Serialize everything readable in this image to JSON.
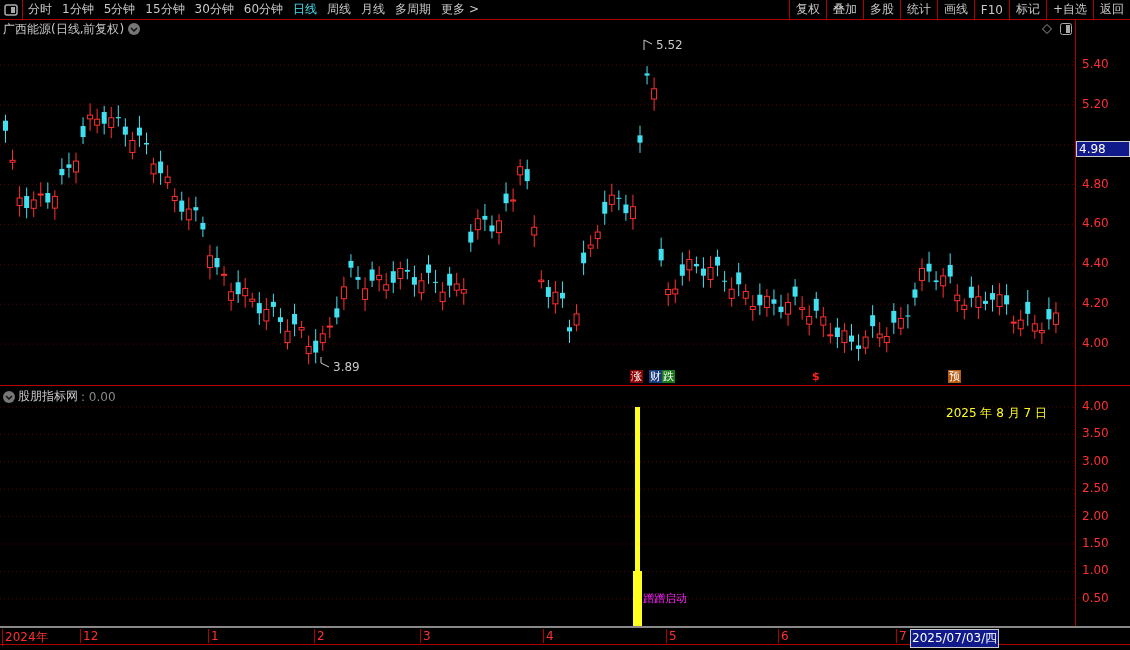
{
  "toolbar": {
    "periods": [
      {
        "label": "分时",
        "selected": false
      },
      {
        "label": "1分钟",
        "selected": false
      },
      {
        "label": "5分钟",
        "selected": false
      },
      {
        "label": "15分钟",
        "selected": false
      },
      {
        "label": "30分钟",
        "selected": false
      },
      {
        "label": "60分钟",
        "selected": false
      },
      {
        "label": "日线",
        "selected": true
      },
      {
        "label": "周线",
        "selected": false
      },
      {
        "label": "月线",
        "selected": false
      },
      {
        "label": "多周期",
        "selected": false
      },
      {
        "label": "更多 >",
        "selected": false
      }
    ],
    "actions": [
      "复权",
      "叠加",
      "多股",
      "统计",
      "画线",
      "F10",
      "标记",
      "+自选",
      "返回"
    ]
  },
  "main_chart": {
    "title": "广西能源(日线,前复权)",
    "price_axis": [
      "5.40",
      "5.20",
      "4.80",
      "4.60",
      "4.40",
      "4.20",
      "4.00"
    ],
    "current_price": "4.98",
    "high_label": "5.52",
    "low_label": "3.89",
    "events": [
      {
        "kind": "badge",
        "text": "涨",
        "color": "#8b0000"
      },
      {
        "kind": "badge",
        "text": "财",
        "color": "#1a3a7a"
      },
      {
        "kind": "badge",
        "text": "跌",
        "color": "#1a7a1a"
      },
      {
        "kind": "glyph",
        "text": "$",
        "color": "#ff2020"
      },
      {
        "kind": "badge",
        "text": "预",
        "color": "#b85a10"
      }
    ]
  },
  "indicator": {
    "name": "股朋指标网",
    "value": ": 0.00",
    "date": "2025 年 8 月 7 日",
    "signal": "蹭蹭启动",
    "axis": [
      "4.00",
      "3.50",
      "3.00",
      "2.50",
      "2.00",
      "1.50",
      "1.00",
      "0.50"
    ]
  },
  "time_axis": {
    "labels": [
      "2024年",
      "12",
      "1",
      "2",
      "3",
      "4",
      "5",
      "6",
      "7"
    ],
    "cursor_date": "2025/07/03/四"
  }
}
